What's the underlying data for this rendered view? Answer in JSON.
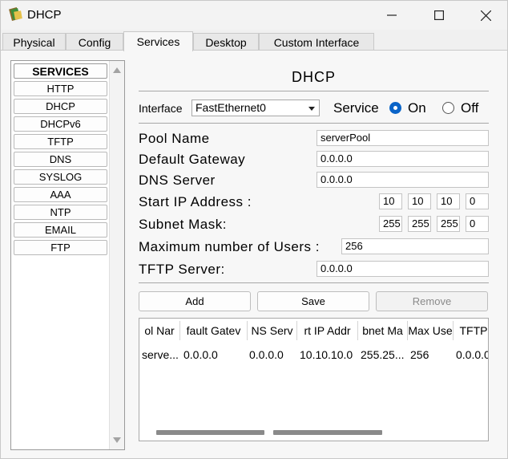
{
  "window": {
    "title": "DHCP"
  },
  "tabs": [
    "Physical",
    "Config",
    "Services",
    "Desktop",
    "Custom Interface"
  ],
  "sidebar": {
    "header": "SERVICES",
    "items": [
      "HTTP",
      "DHCP",
      "DHCPv6",
      "TFTP",
      "DNS",
      "SYSLOG",
      "AAA",
      "NTP",
      "EMAIL",
      "FTP"
    ]
  },
  "panel": {
    "title": "DHCP",
    "interface_label": "Interface",
    "interface_value": "FastEthernet0",
    "service_label": "Service",
    "on_label": "On",
    "off_label": "Off",
    "service_state": "On"
  },
  "form": {
    "pool_name_label": "Pool Name",
    "pool_name": "serverPool",
    "default_gateway_label": "Default Gateway",
    "default_gateway": "0.0.0.0",
    "dns_server_label": "DNS Server",
    "dns_server": "0.0.0.0",
    "start_ip_label": "Start IP Address :",
    "start_ip": [
      "10",
      "10",
      "10",
      "0"
    ],
    "subnet_mask_label": "Subnet Mask:",
    "subnet_mask": [
      "255",
      "255",
      "255",
      "0"
    ],
    "max_users_label": "Maximum number of Users :",
    "max_users": "256",
    "tftp_server_label": "TFTP Server:",
    "tftp_server": "0.0.0.0"
  },
  "buttons": {
    "add": "Add",
    "save": "Save",
    "remove": "Remove"
  },
  "table": {
    "headers": [
      "ol Nar",
      "fault Gatev",
      "NS Serv",
      "rt IP Addr",
      "bnet Ma",
      "Max Use",
      "TFTP"
    ],
    "rows": [
      [
        "serve...",
        "0.0.0.0",
        "0.0.0.0",
        "10.10.10.0",
        "255.25...",
        "256",
        "0.0.0.0"
      ]
    ]
  }
}
